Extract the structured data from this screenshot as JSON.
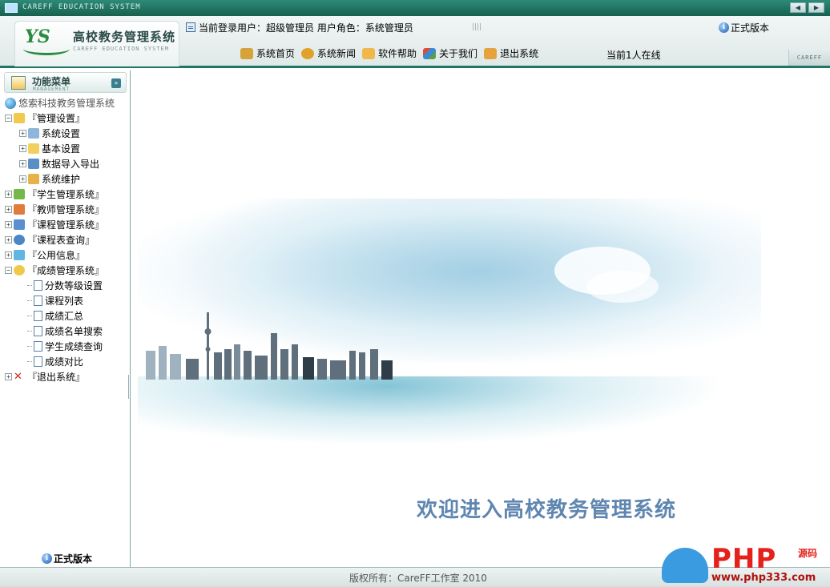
{
  "window": {
    "title_strip": "CAREFF EDUCATION SYSTEM",
    "nav_prev": "◀",
    "nav_next": "▶"
  },
  "header": {
    "logo_mark": "YS",
    "app_title": "高校教务管理系统",
    "app_subtitle": "CAREFF EDUCATION SYSTEM",
    "user_info": "当前登录用户：超级管理员  用户角色：系统管理员",
    "version": "正式版本",
    "online": "当前1人在线",
    "corner_tag": "CAREFF",
    "nav": [
      {
        "label": "系统首页",
        "icon": "home-icon",
        "color": "#d6a23a"
      },
      {
        "label": "系统新闻",
        "icon": "news-icon",
        "color": "#e0a22a"
      },
      {
        "label": "软件帮助",
        "icon": "help-icon",
        "color": "#f0b84a"
      },
      {
        "label": "关于我们",
        "icon": "about-icon",
        "color": "#5aa04a"
      },
      {
        "label": "退出系统",
        "icon": "logout-icon",
        "color": "#e6a23c"
      }
    ]
  },
  "sidebar": {
    "menu_title": "功能菜单",
    "menu_subtitle": "MANAGEMENT",
    "toggle": "»",
    "root": "悠索科技教务管理系统",
    "nodes": [
      {
        "label": "『管理设置』",
        "level": 0,
        "expander": "−",
        "icon": "folder-open-icon",
        "color": "#f2c94c"
      },
      {
        "label": "系统设置",
        "level": 1,
        "expander": "+",
        "icon": "settings-icon",
        "color": "#8fb6d8"
      },
      {
        "label": "基本设置",
        "level": 1,
        "expander": "+",
        "icon": "pencil-icon",
        "color": "#f0d060"
      },
      {
        "label": "数据导入导出",
        "level": 1,
        "expander": "+",
        "icon": "data-transfer-icon",
        "color": "#5a8fc4"
      },
      {
        "label": "系统维护",
        "level": 1,
        "expander": "+",
        "icon": "maintenance-icon",
        "color": "#e6b24a"
      },
      {
        "label": "『学生管理系统』",
        "level": 0,
        "expander": "+",
        "icon": "student-icon",
        "color": "#74b84c"
      },
      {
        "label": "『教师管理系统』",
        "level": 0,
        "expander": "+",
        "icon": "teacher-icon",
        "color": "#e07b3c"
      },
      {
        "label": "『课程管理系统』",
        "level": 0,
        "expander": "+",
        "icon": "course-icon",
        "color": "#5b8fd0"
      },
      {
        "label": "『课程表查询』",
        "level": 0,
        "expander": "+",
        "icon": "search-icon",
        "color": "#4a86c8"
      },
      {
        "label": "『公用信息』",
        "level": 0,
        "expander": "+",
        "icon": "info-board-icon",
        "color": "#5fb6e0"
      },
      {
        "label": "『成绩管理系统』",
        "level": 0,
        "expander": "−",
        "icon": "chart-pie-icon",
        "color": "#f0c84a"
      },
      {
        "label": "分数等级设置",
        "level": 2,
        "expander": "",
        "icon": "page-icon",
        "color": "#ffffff"
      },
      {
        "label": "课程列表",
        "level": 2,
        "expander": "",
        "icon": "page-icon",
        "color": "#ffffff"
      },
      {
        "label": "成绩汇总",
        "level": 2,
        "expander": "",
        "icon": "page-icon",
        "color": "#ffffff"
      },
      {
        "label": "成绩名单搜索",
        "level": 2,
        "expander": "",
        "icon": "page-icon",
        "color": "#ffffff"
      },
      {
        "label": "学生成绩查询",
        "level": 2,
        "expander": "",
        "icon": "page-icon",
        "color": "#ffffff"
      },
      {
        "label": "成绩对比",
        "level": 2,
        "expander": "",
        "icon": "page-icon",
        "color": "#ffffff"
      },
      {
        "label": "『退出系统』",
        "level": 0,
        "expander": "+",
        "icon": "exit-x-icon",
        "color": "#d8231c"
      }
    ],
    "version": "正式版本"
  },
  "main": {
    "welcome": "欢迎进入高校教务管理系统"
  },
  "footer": {
    "copyright": "版权所有：CareFF工作室  2010"
  },
  "watermark": {
    "brand": "PHP",
    "suffix": "源码",
    "site": "www.php333.com"
  }
}
